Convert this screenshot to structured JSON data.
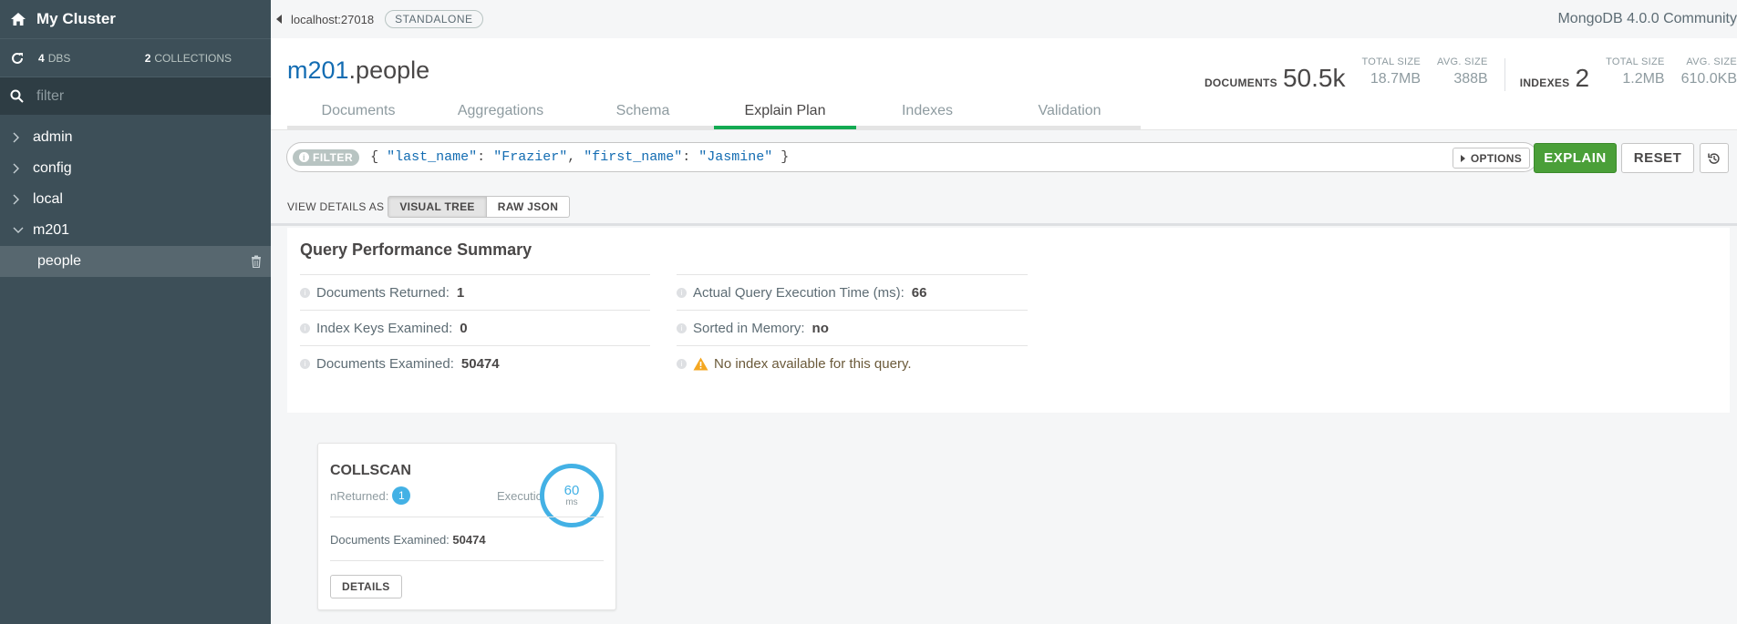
{
  "sidebar": {
    "cluster_name": "My Cluster",
    "dbs_count": "4",
    "dbs_label": "DBS",
    "collections_count": "2",
    "collections_label": "COLLECTIONS",
    "filter_placeholder": "filter",
    "databases": [
      {
        "name": "admin",
        "expanded": false
      },
      {
        "name": "config",
        "expanded": false
      },
      {
        "name": "local",
        "expanded": false
      },
      {
        "name": "m201",
        "expanded": true
      }
    ],
    "active_collection": "people"
  },
  "topbar": {
    "host": "localhost:27018",
    "topology": "STANDALONE",
    "version": "MongoDB 4.0.0 Community"
  },
  "header": {
    "db": "m201",
    "collection": ".people",
    "documents_label": "DOCUMENTS",
    "documents_value": "50.5k",
    "total_size_label": "TOTAL SIZE",
    "total_size_value": "18.7MB",
    "avg_size_label": "AVG. SIZE",
    "avg_size_value": "388B",
    "indexes_label": "INDEXES",
    "indexes_value": "2",
    "idx_total_size_label": "TOTAL SIZE",
    "idx_total_size_value": "1.2MB",
    "idx_avg_size_label": "AVG. SIZE",
    "idx_avg_size_value": "610.0KB"
  },
  "tabs": [
    {
      "label": "Documents",
      "active": false
    },
    {
      "label": "Aggregations",
      "active": false
    },
    {
      "label": "Schema",
      "active": false
    },
    {
      "label": "Explain Plan",
      "active": true
    },
    {
      "label": "Indexes",
      "active": false
    },
    {
      "label": "Validation",
      "active": false
    }
  ],
  "query": {
    "filter_label": "FILTER",
    "open": "{",
    "k1": "\"last_name\"",
    "v1": "\"Frazier\"",
    "k2": "\"first_name\"",
    "v2": "\"Jasmine\"",
    "close": "}",
    "options_label": "OPTIONS",
    "explain_label": "EXPLAIN",
    "reset_label": "RESET"
  },
  "view_details": {
    "label": "VIEW DETAILS AS",
    "visual_tree": "VISUAL TREE",
    "raw_json": "RAW JSON",
    "selected": "VISUAL TREE"
  },
  "summary": {
    "title": "Query Performance Summary",
    "docs_returned_label": "Documents Returned:",
    "docs_returned_value": "1",
    "keys_examined_label": "Index Keys Examined:",
    "keys_examined_value": "0",
    "docs_examined_label": "Documents Examined:",
    "docs_examined_value": "50474",
    "exec_time_label": "Actual Query Execution Time (ms):",
    "exec_time_value": "66",
    "sorted_label": "Sorted in Memory:",
    "sorted_value": "no",
    "warning": "No index available for this query."
  },
  "stage": {
    "name": "COLLSCAN",
    "nreturned_label": "nReturned:",
    "nreturned_value": "1",
    "exec_time_label": "Execution Time:",
    "exec_time_value": "60",
    "exec_time_unit": "ms",
    "docs_examined_label": "Documents Examined:",
    "docs_examined_value": "50474",
    "details_label": "DETAILS"
  },
  "colors": {
    "sidebar_bg": "#3d4f58",
    "accent_green": "#13aa52",
    "explain_green": "#4a9f38",
    "link_blue": "#136cb2",
    "stage_blue": "#43b1e5",
    "warning_orange": "#f4a721"
  }
}
